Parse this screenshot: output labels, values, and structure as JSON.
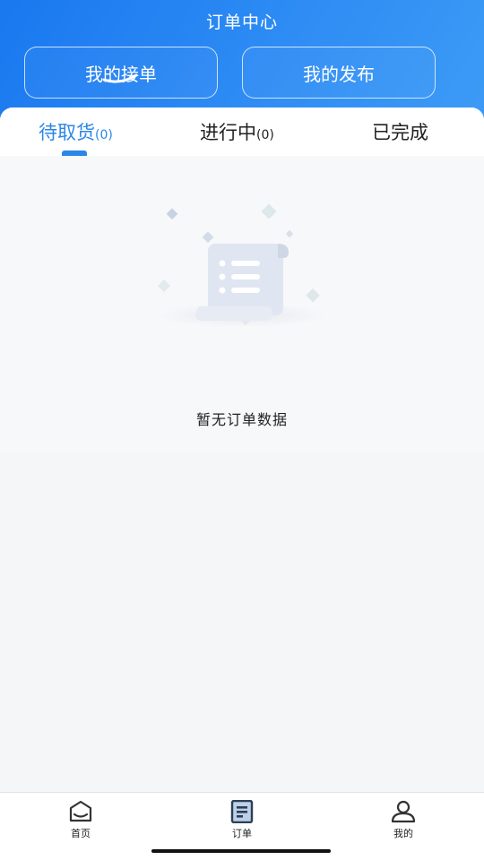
{
  "header": {
    "title": "订单中心",
    "segments": [
      {
        "label": "我的接单",
        "selected": true
      },
      {
        "label": "我的发布",
        "selected": false
      }
    ]
  },
  "tabs": [
    {
      "label": "待取货",
      "count": "(0)",
      "active": true
    },
    {
      "label": "进行中",
      "count": "(0)",
      "active": false
    },
    {
      "label": "已完成",
      "count": "",
      "active": false
    }
  ],
  "empty_state": {
    "icon": "empty-document-icon",
    "text": "暂无订单数据"
  },
  "bottom_nav": [
    {
      "label": "首页",
      "icon": "home-icon",
      "active": false
    },
    {
      "label": "订单",
      "icon": "order-list-icon",
      "active": true
    },
    {
      "label": "我的",
      "icon": "user-icon",
      "active": false
    }
  ],
  "colors": {
    "header_gradient_start": "#1a78f0",
    "header_gradient_end": "#3d9bf6",
    "accent": "#2b86e6",
    "background": "#f5f6f8"
  }
}
